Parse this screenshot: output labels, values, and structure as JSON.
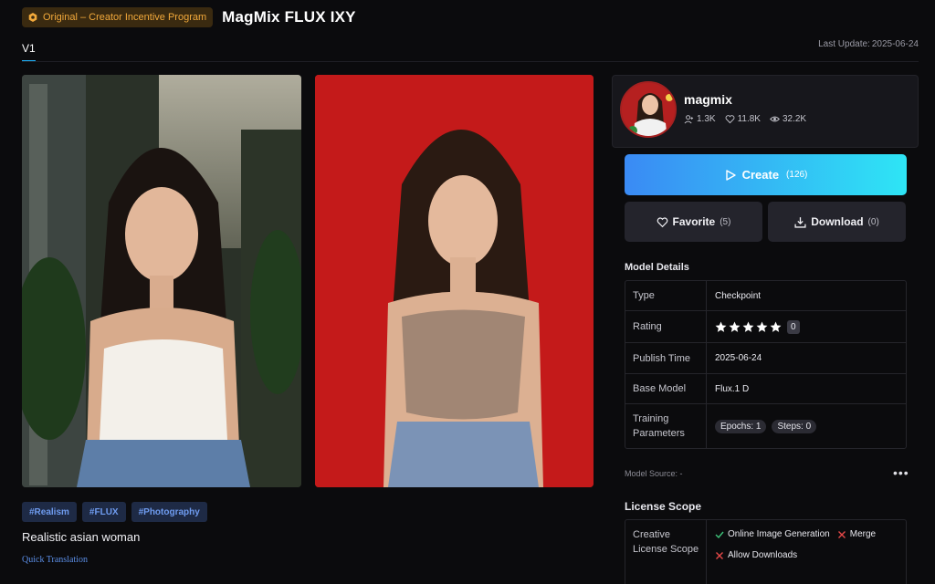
{
  "header": {
    "badge": "Original – Creator Incentive Program",
    "title": "MagMix FLUX IXY"
  },
  "tabs": [
    {
      "label": "V1"
    }
  ],
  "last_update": {
    "label": "Last Update:",
    "value": "2025-06-24"
  },
  "tags": [
    "#Realism",
    "#FLUX",
    "#Photography"
  ],
  "description": "Realistic asian woman",
  "quick_translation": "Quick Translation",
  "creator": {
    "name": "magmix",
    "followers": "1.3K",
    "likes": "11.8K",
    "views": "32.2K"
  },
  "actions": {
    "create_label": "Create",
    "create_count": "(126)",
    "favorite_label": "Favorite",
    "favorite_count": "(5)",
    "download_label": "Download",
    "download_count": "(0)"
  },
  "model_details": {
    "title": "Model Details",
    "type_label": "Type",
    "type_value": "Checkpoint",
    "rating_label": "Rating",
    "rating_stars": 5,
    "rating_count": "0",
    "publish_label": "Publish Time",
    "publish_value": "2025-06-24",
    "base_label": "Base Model",
    "base_value": "Flux.1 D",
    "training_label": "Training Parameters",
    "epochs_label": "Epochs:",
    "epochs_value": "1",
    "steps_label": "Steps:",
    "steps_value": "0"
  },
  "model_source": "Model Source: -",
  "more_label": "•••",
  "license": {
    "title": "License Scope",
    "label": "Creative License Scope",
    "items": [
      {
        "label": "Online Image Generation",
        "allowed": true
      },
      {
        "label": "Merge",
        "allowed": false
      },
      {
        "label": "Allow Downloads",
        "allowed": false
      }
    ]
  },
  "colors": {
    "accent_start": "#3a8af4",
    "accent_end": "#2ee5f5",
    "badge_text": "#f2a93b",
    "tag_text": "#6f9cf0",
    "allowed": "#3ec47a",
    "denied": "#e54848"
  }
}
